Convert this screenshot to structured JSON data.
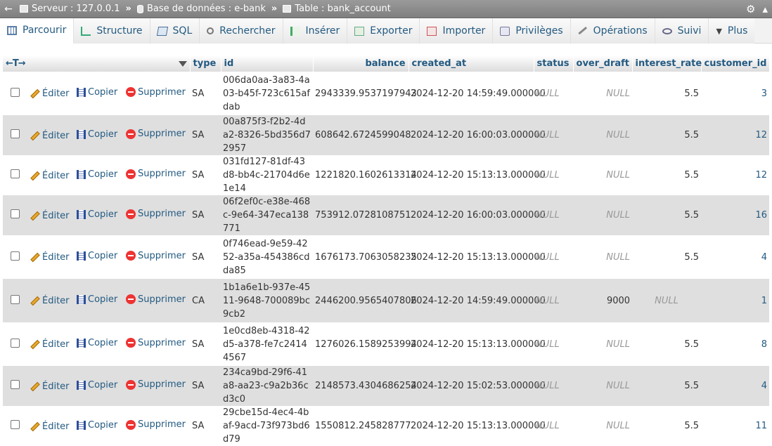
{
  "breadcrumb": {
    "server": "Serveur : 127.0.0.1",
    "database": "Base de données : e-bank",
    "table": "Table : bank_account"
  },
  "tabs": [
    {
      "label": "Parcourir",
      "icon": "browse-icon",
      "active": true
    },
    {
      "label": "Structure",
      "icon": "structure-icon"
    },
    {
      "label": "SQL",
      "icon": "sql-icon"
    },
    {
      "label": "Rechercher",
      "icon": "search-icon"
    },
    {
      "label": "Insérer",
      "icon": "insert-icon"
    },
    {
      "label": "Exporter",
      "icon": "export-icon"
    },
    {
      "label": "Importer",
      "icon": "import-icon"
    },
    {
      "label": "Privilèges",
      "icon": "privileges-icon"
    },
    {
      "label": "Opérations",
      "icon": "operations-icon"
    },
    {
      "label": "Suivi",
      "icon": "tracking-icon"
    },
    {
      "label": "Plus",
      "icon": "chevron-down-icon"
    }
  ],
  "columns": [
    "type",
    "id",
    "balance",
    "created_at",
    "status",
    "over_draft",
    "interest_rate",
    "customer_id"
  ],
  "actions": {
    "edit": "Éditer",
    "copy": "Copier",
    "delete": "Supprimer"
  },
  "arrows": "←T→",
  "rows": [
    {
      "type": "SA",
      "id": "006da0aa-3a83-4a03-b45f-723c615afdab",
      "balance": "2943339.9537197943",
      "created_at": "2024-12-20 14:59:49.000000",
      "status": "NULL",
      "over_draft": "NULL",
      "interest_rate": "5.5",
      "customer_id": "3"
    },
    {
      "type": "SA",
      "id": "00a875f3-f2b2-4da2-8326-5bd356d72957",
      "balance": "608642.6724599048",
      "created_at": "2024-12-20 16:00:03.000000",
      "status": "NULL",
      "over_draft": "NULL",
      "interest_rate": "5.5",
      "customer_id": "12"
    },
    {
      "type": "SA",
      "id": "031fd127-81df-43d8-bb4c-21704d6e1e14",
      "balance": "1221820.1602613314",
      "created_at": "2024-12-20 15:13:13.000000",
      "status": "NULL",
      "over_draft": "NULL",
      "interest_rate": "5.5",
      "customer_id": "12"
    },
    {
      "type": "SA",
      "id": "06f2ef0c-e38e-468c-9e64-347eca138771",
      "balance": "753912.0728108751",
      "created_at": "2024-12-20 16:00:03.000000",
      "status": "NULL",
      "over_draft": "NULL",
      "interest_rate": "5.5",
      "customer_id": "16"
    },
    {
      "type": "SA",
      "id": "0f746ead-9e59-4252-a35a-454386cdda85",
      "balance": "1676173.7063058235",
      "created_at": "2024-12-20 15:13:13.000000",
      "status": "NULL",
      "over_draft": "NULL",
      "interest_rate": "5.5",
      "customer_id": "4"
    },
    {
      "type": "CA",
      "id": "1b1a6e1b-937e-4511-9648-700089bc9cb2",
      "balance": "2446200.9565407806",
      "created_at": "2024-12-20 14:59:49.000000",
      "status": "NULL",
      "over_draft": "9000",
      "interest_rate": "NULL",
      "customer_id": "1"
    },
    {
      "type": "SA",
      "id": "1e0cd8eb-4318-42d5-a378-fe7c24144567",
      "balance": "1276026.1589253994",
      "created_at": "2024-12-20 15:13:13.000000",
      "status": "NULL",
      "over_draft": "NULL",
      "interest_rate": "5.5",
      "customer_id": "8"
    },
    {
      "type": "SA",
      "id": "234ca9bd-29f6-41a8-aa23-c9a2b36cd3c0",
      "balance": "2148573.4304686254",
      "created_at": "2024-12-20 15:02:53.000000",
      "status": "NULL",
      "over_draft": "NULL",
      "interest_rate": "5.5",
      "customer_id": "4"
    },
    {
      "type": "SA",
      "id": "29cbe15d-4ec4-4baf-9acd-73f973bd6d79",
      "balance": "1550812.245828777",
      "created_at": "2024-12-20 15:13:13.000000",
      "status": "NULL",
      "over_draft": "NULL",
      "interest_rate": "5.5",
      "customer_id": "11"
    }
  ]
}
